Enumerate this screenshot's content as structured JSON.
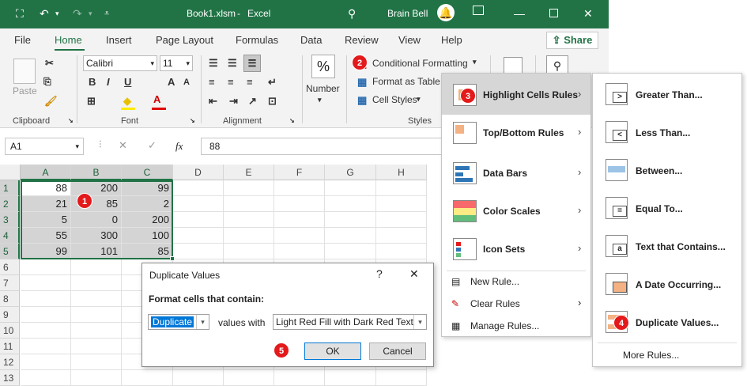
{
  "window": {
    "filename": "Book1.xlsm",
    "title_sep": "-",
    "app": "Excel",
    "user": "Brain Bell"
  },
  "tabs": [
    "File",
    "Home",
    "Insert",
    "Page Layout",
    "Formulas",
    "Data",
    "Review",
    "View",
    "Help"
  ],
  "share_label": "Share",
  "ribbon": {
    "paste": "Paste",
    "font_name": "Calibri",
    "font_size": "11",
    "number": "Number",
    "conditional_formatting": "Conditional Formatting",
    "format_as_table": "Format as Table",
    "cell_styles": "Cell Styles",
    "groups": {
      "clipboard": "Clipboard",
      "font": "Font",
      "alignment": "Alignment",
      "styles": "Styles"
    }
  },
  "formula_bar": {
    "name_box": "A1",
    "fx": "fx",
    "value": "88"
  },
  "columns": [
    "A",
    "B",
    "C",
    "D",
    "E",
    "F",
    "G",
    "H"
  ],
  "rows": [
    "1",
    "2",
    "3",
    "4",
    "5",
    "6",
    "7",
    "8",
    "9",
    "10",
    "11",
    "12",
    "13"
  ],
  "cells": [
    [
      "88",
      "200",
      "99"
    ],
    [
      "21",
      "85",
      "2"
    ],
    [
      "5",
      "0",
      "200"
    ],
    [
      "55",
      "300",
      "100"
    ],
    [
      "99",
      "101",
      "85"
    ]
  ],
  "dialog": {
    "title": "Duplicate Values",
    "help": "?",
    "close": "✕",
    "prompt": "Format cells that contain:",
    "type_value": "Duplicate",
    "values_with": "values with",
    "format_value": "Light Red Fill with Dark Red Text",
    "ok": "OK",
    "cancel": "Cancel"
  },
  "cf_menu": {
    "items": [
      "Highlight Cells Rules",
      "Top/Bottom Rules",
      "Data Bars",
      "Color Scales",
      "Icon Sets"
    ],
    "new_rule": "New Rule...",
    "clear_rules": "Clear Rules",
    "manage_rules": "Manage Rules..."
  },
  "highlight_submenu": {
    "items": [
      "Greater Than...",
      "Less Than...",
      "Between...",
      "Equal To...",
      "Text that Contains...",
      "A Date Occurring...",
      "Duplicate Values..."
    ],
    "more_rules": "More Rules..."
  },
  "badges": [
    "1",
    "2",
    "3",
    "4",
    "5"
  ],
  "colors": {
    "excel_green": "#217346",
    "badge_red": "#e3191b",
    "selection_gray": "#d4d4d4"
  }
}
